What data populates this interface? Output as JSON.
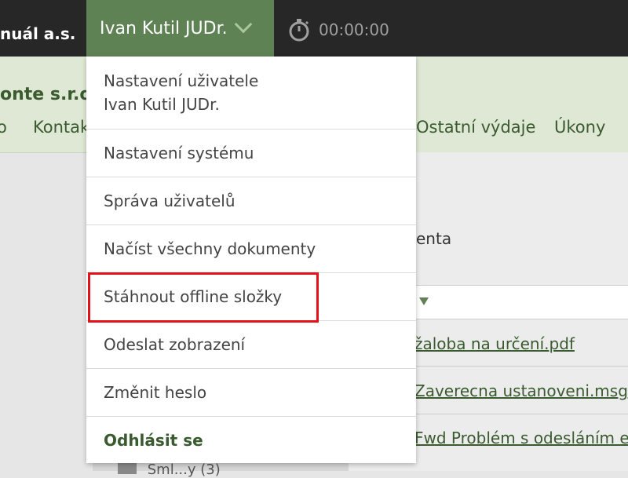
{
  "topbar": {
    "company": "nuál a.s.",
    "user": "Ivan Kutil JUDr.",
    "timer": "00:00:00"
  },
  "header": {
    "client": "onte s.r.o",
    "nav": [
      "o",
      "Kontak",
      "Ostatní výdaje",
      "Úkony"
    ]
  },
  "main": {
    "label": "enta",
    "files": [
      "žaloba na určení.pdf",
      "Zaverecna ustanoveni.msg",
      "Fwd Problém s odesláním e"
    ],
    "folder": "Sml...y (3)"
  },
  "menu": {
    "user_settings_line1": "Nastavení uživatele",
    "user_settings_line2": "Ivan Kutil JUDr.",
    "items": [
      "Nastavení systému",
      "Správa uživatelů",
      "Načíst všechny dokumenty",
      "Stáhnout offline složky",
      "Odeslat zobrazení",
      "Změnit heslo",
      "Odhlásit se"
    ]
  },
  "colors": {
    "topbar": "#272727",
    "user_button": "#5f8254",
    "header_band": "#dfe8d5",
    "highlight": "#e3111a"
  }
}
